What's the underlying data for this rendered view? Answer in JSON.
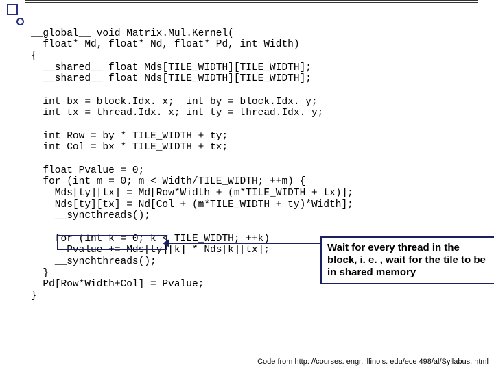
{
  "code": {
    "l1": "__global__ void Matrix.Mul.Kernel(",
    "l2": "  float* Md, float* Nd, float* Pd, int Width)",
    "l3": "{",
    "l4": "  __shared__ float Mds[TILE_WIDTH][TILE_WIDTH];",
    "l5": "  __shared__ float Nds[TILE_WIDTH][TILE_WIDTH];",
    "sp1": "",
    "l6": "  int bx = block.Idx. x;  int by = block.Idx. y;",
    "l7": "  int tx = thread.Idx. x; int ty = thread.Idx. y;",
    "sp2": "",
    "l8": "  int Row = by * TILE_WIDTH + ty;",
    "l9": "  int Col = bx * TILE_WIDTH + tx;",
    "sp3": "",
    "l10": "  float Pvalue = 0;",
    "l11": "  for (int m = 0; m < Width/TILE_WIDTH; ++m) {",
    "l12": "    Mds[ty][tx] = Md[Row*Width + (m*TILE_WIDTH + tx)];",
    "l13": "    Nds[ty][tx] = Nd[Col + (m*TILE_WIDTH + ty)*Width];",
    "l14": "    __syncthreads();",
    "sp4": "",
    "l15": "    for (int k = 0; k < TILE_WIDTH; ++k)",
    "l16": "      Pvalue += Mds[ty][k] * Nds[k][tx];",
    "l17": "    __synchthreads();",
    "l18": "  }",
    "l19": "  Pd[Row*Width+Col] = Pvalue;",
    "l20": "}"
  },
  "callout": "Wait for every thread in the block, i. e. , wait for the tile to be in shared memory",
  "source": "Code from http: //courses. engr. illinois. edu/ece 498/al/Syllabus. html"
}
